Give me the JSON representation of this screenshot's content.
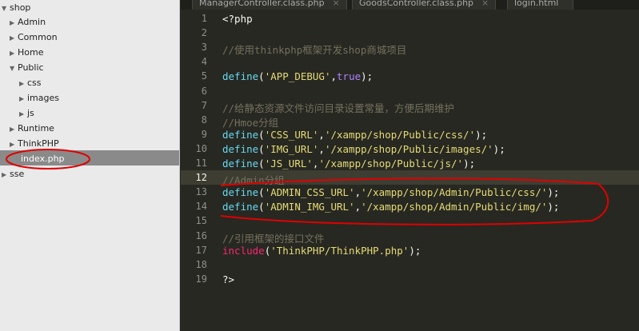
{
  "sidebar": {
    "tree": [
      {
        "label": "shop",
        "arrow": "▼"
      },
      {
        "label": "Admin",
        "arrow": "▶"
      },
      {
        "label": "Common",
        "arrow": "▶"
      },
      {
        "label": "Home",
        "arrow": "▶"
      },
      {
        "label": "Public",
        "arrow": "▼"
      },
      {
        "label": "css",
        "arrow": "▶"
      },
      {
        "label": "images",
        "arrow": "▶"
      },
      {
        "label": "js",
        "arrow": "▶"
      },
      {
        "label": "Runtime",
        "arrow": "▶"
      },
      {
        "label": "ThinkPHP",
        "arrow": "▶"
      },
      {
        "label": "index.php",
        "arrow": ""
      },
      {
        "label": "sse",
        "arrow": "▶"
      }
    ]
  },
  "tabs": [
    {
      "label": "ManagerController.class.php",
      "close": "×"
    },
    {
      "label": "GoodsController.class.php",
      "close": "×"
    },
    {
      "label": "login.html",
      "close": ""
    }
  ],
  "editor": {
    "line_numbers": [
      "1",
      "2",
      "3",
      "4",
      "5",
      "6",
      "7",
      "8",
      "9",
      "10",
      "11",
      "12",
      "13",
      "14",
      "15",
      "16",
      "17",
      "18",
      "19"
    ],
    "current_line": 12,
    "lines": [
      [
        {
          "t": "<?php",
          "c": "pl"
        }
      ],
      [],
      [
        {
          "t": "//使用thinkphp框架开发shop商城项目",
          "c": "cmt"
        }
      ],
      [],
      [
        {
          "t": "define",
          "c": "fn"
        },
        {
          "t": "(",
          "c": "pl"
        },
        {
          "t": "'APP_DEBUG'",
          "c": "str"
        },
        {
          "t": ",",
          "c": "pl"
        },
        {
          "t": "true",
          "c": "num"
        },
        {
          "t": ");",
          "c": "pl"
        }
      ],
      [],
      [
        {
          "t": "//给静态资源文件访问目录设置常量，方便后期维护",
          "c": "cmt"
        }
      ],
      [
        {
          "t": "//Hmoe分组",
          "c": "cmt"
        }
      ],
      [
        {
          "t": "define",
          "c": "fn"
        },
        {
          "t": "(",
          "c": "pl"
        },
        {
          "t": "'CSS_URL'",
          "c": "str"
        },
        {
          "t": ",",
          "c": "pl"
        },
        {
          "t": "'/xampp/shop/Public/css/'",
          "c": "str"
        },
        {
          "t": ");",
          "c": "pl"
        }
      ],
      [
        {
          "t": "define",
          "c": "fn"
        },
        {
          "t": "(",
          "c": "pl"
        },
        {
          "t": "'IMG_URL'",
          "c": "str"
        },
        {
          "t": ",",
          "c": "pl"
        },
        {
          "t": "'/xampp/shop/Public/images/'",
          "c": "str"
        },
        {
          "t": ");",
          "c": "pl"
        }
      ],
      [
        {
          "t": "define",
          "c": "fn"
        },
        {
          "t": "(",
          "c": "pl"
        },
        {
          "t": "'JS_URL'",
          "c": "str"
        },
        {
          "t": ",",
          "c": "pl"
        },
        {
          "t": "'/xampp/shop/Public/js/'",
          "c": "str"
        },
        {
          "t": ");",
          "c": "pl"
        }
      ],
      [
        {
          "t": "//Admin分组",
          "c": "cmt"
        }
      ],
      [
        {
          "t": "define",
          "c": "fn"
        },
        {
          "t": "(",
          "c": "pl"
        },
        {
          "t": "'ADMIN_CSS_URL'",
          "c": "str"
        },
        {
          "t": ",",
          "c": "pl"
        },
        {
          "t": "'/xampp/shop/Admin/Public/css/'",
          "c": "str"
        },
        {
          "t": ");",
          "c": "pl"
        }
      ],
      [
        {
          "t": "define",
          "c": "fn"
        },
        {
          "t": "(",
          "c": "pl"
        },
        {
          "t": "'ADMIN_IMG_URL'",
          "c": "str"
        },
        {
          "t": ",",
          "c": "pl"
        },
        {
          "t": "'/xampp/shop/Admin/Public/img/'",
          "c": "str"
        },
        {
          "t": ");",
          "c": "pl"
        }
      ],
      [],
      [
        {
          "t": "//引用框架的接口文件",
          "c": "cmt"
        }
      ],
      [
        {
          "t": "include",
          "c": "kw"
        },
        {
          "t": "(",
          "c": "pl"
        },
        {
          "t": "'ThinkPHP/ThinkPHP.php'",
          "c": "str"
        },
        {
          "t": ");",
          "c": "pl"
        }
      ],
      [],
      [
        {
          "t": "?>",
          "c": "pl"
        }
      ]
    ]
  },
  "colors": {
    "annotation": "#e00000",
    "editor_bg": "#272822",
    "sidebar_bg": "#eaeaea"
  }
}
